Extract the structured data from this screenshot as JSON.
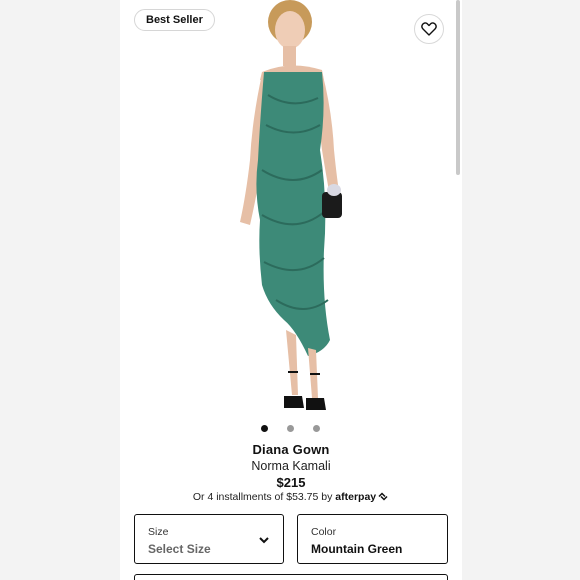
{
  "badge": {
    "label": "Best Seller"
  },
  "icons": {
    "favorite": "heart-outline-icon",
    "size_dropdown": "chevron-down-icon",
    "afterpay": "afterpay-arrows-icon"
  },
  "gallery": {
    "image_count": 3,
    "active_index": 0
  },
  "product": {
    "name": "Diana Gown",
    "brand": "Norma Kamali",
    "price": "$215",
    "installments_text": "Or 4 installments of $53.75 by",
    "installments_provider": "afterpay"
  },
  "size": {
    "label": "Size",
    "value": "Select Size"
  },
  "color": {
    "label": "Color",
    "value": "Mountain Green"
  },
  "colors": {
    "dress": "#3d8a78",
    "dress_shadow": "#2c6b5c",
    "skin": "#e6bfa6",
    "accent": "#111111"
  }
}
